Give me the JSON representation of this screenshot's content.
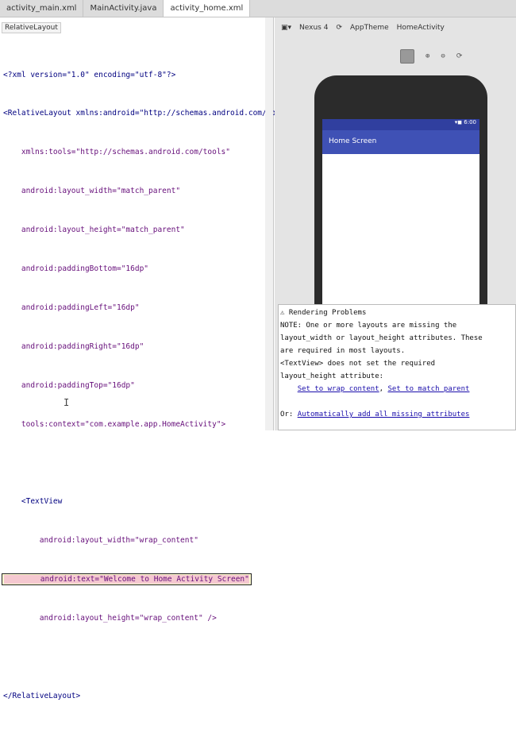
{
  "tabs": [
    {
      "label": "activity_main.xml"
    },
    {
      "label": "MainActivity.java"
    },
    {
      "label": "activity_home.xml"
    }
  ],
  "breadcrumb": "RelativeLayout",
  "code": [
    "<?xml version=\"1.0\" encoding=\"utf-8\"?>",
    "<RelativeLayout xmlns:android=\"http://schemas.android.com/apk/res/android\"",
    "    xmlns:tools=\"http://schemas.android.com/tools\"",
    "    android:layout_width=\"match_parent\"",
    "    android:layout_height=\"match_parent\"",
    "    android:paddingBottom=\"16dp\"",
    "    android:paddingLeft=\"16dp\"",
    "    android:paddingRight=\"16dp\"",
    "    android:paddingTop=\"16dp\"",
    "    tools:context=\"com.example.app.HomeActivity\">",
    "",
    "    <TextView",
    "        android:layout_width=\"wrap_content\"",
    "        android:text=\"Welcome to Home Activity Screen\"",
    "        android:layout_height=\"wrap_content\" />",
    "",
    "</RelativeLayout>"
  ],
  "preview": {
    "title": "Preview",
    "device": "Nexus 4",
    "theme": "AppTheme",
    "activity": "HomeActivity",
    "app_title": "Home Screen"
  },
  "issues": {
    "header": "Rendering Problems",
    "l1": "NOTE: One or more layouts are missing the",
    "l2": "layout_width or layout_height attributes. These",
    "l3": "are required in most layouts.",
    "l4": "<TextView> does not set the required",
    "l5": "layout_height attribute:",
    "fix1": "Set to wrap_content",
    "sep": ", ",
    "fix2": "Set to match_parent",
    "or": "Or: ",
    "fix3": "Automatically add all missing attributes"
  }
}
